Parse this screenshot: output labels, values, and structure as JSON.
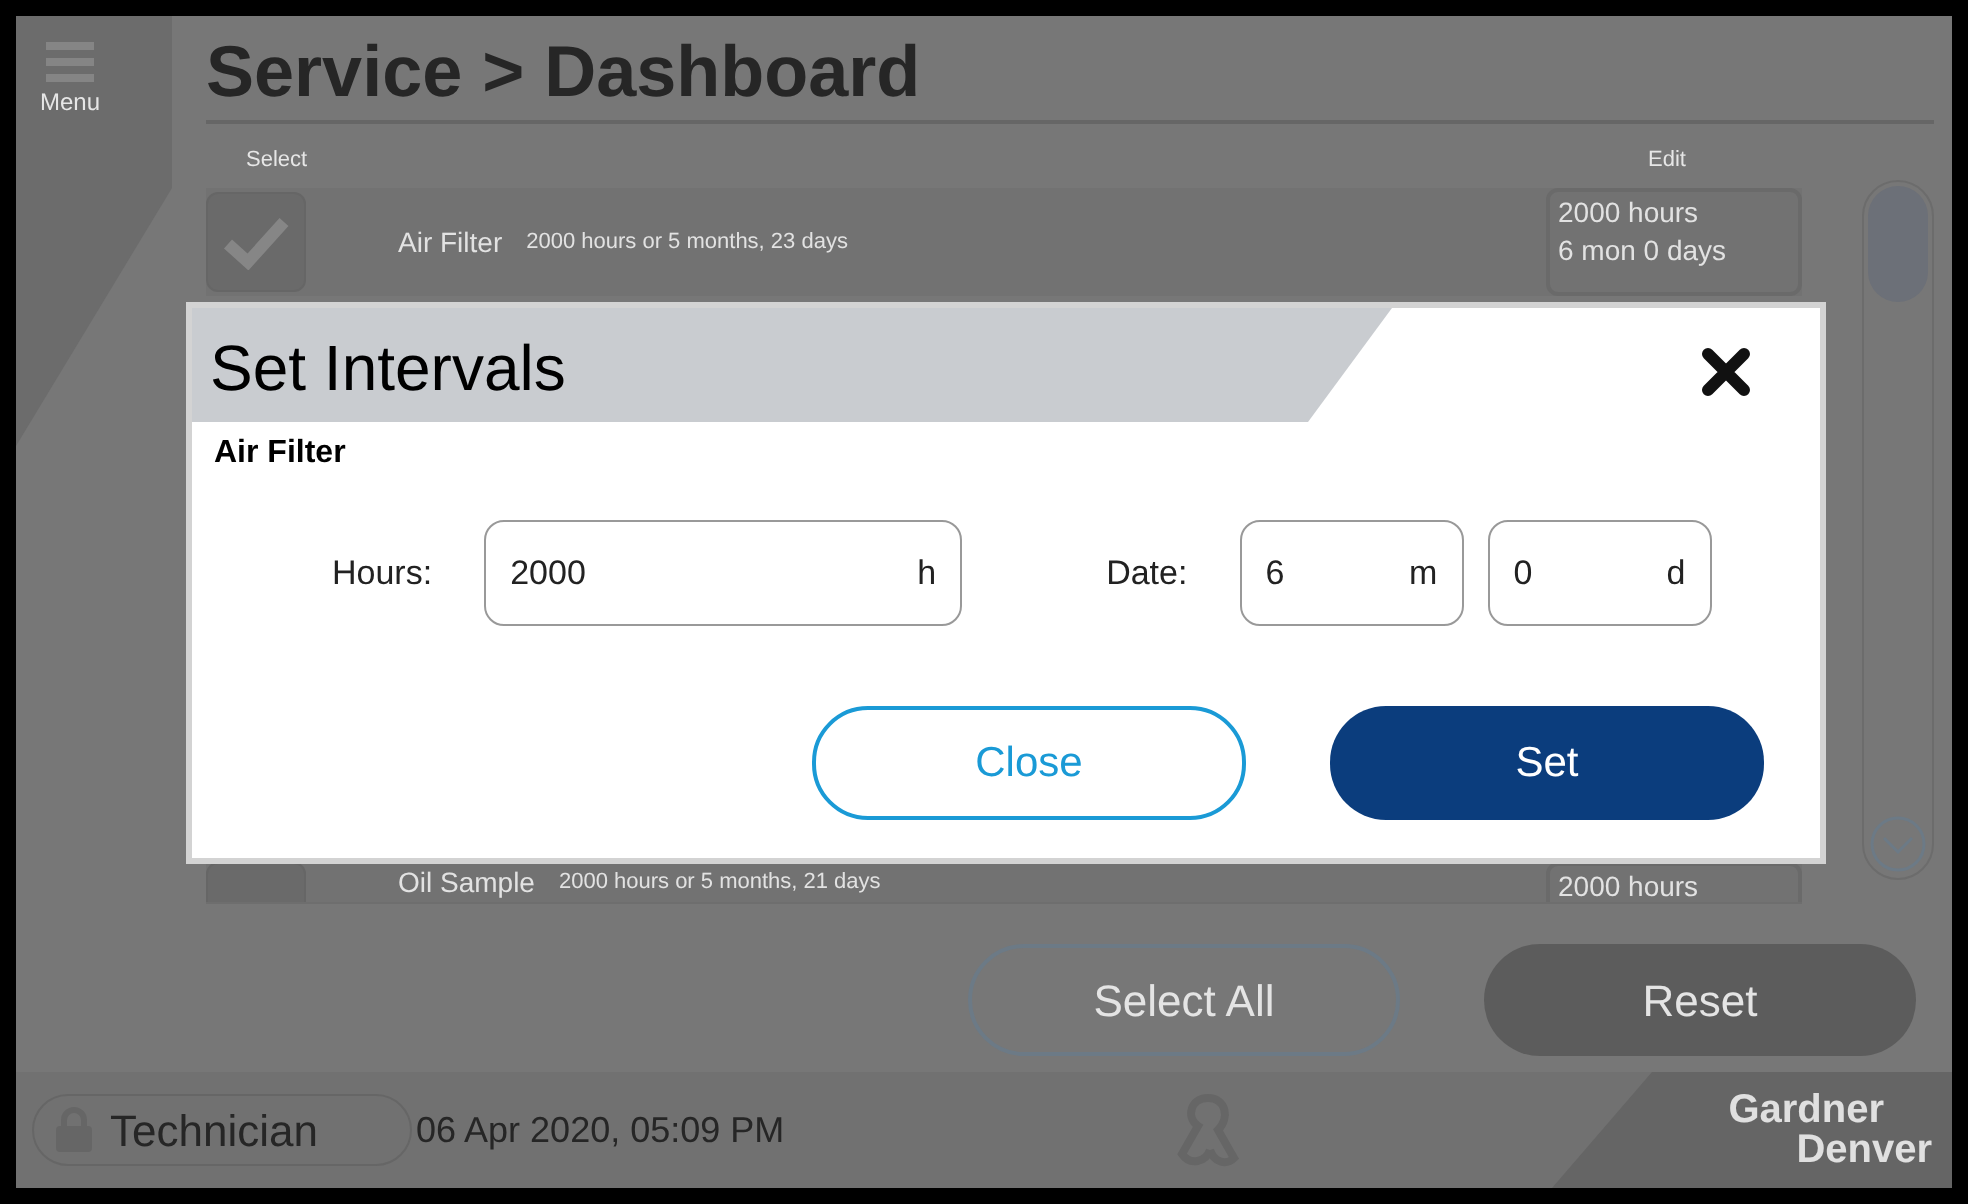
{
  "header": {
    "menu_label": "Menu",
    "title": "Service > Dashboard"
  },
  "list": {
    "select_heading": "Select",
    "edit_heading": "Edit",
    "items": [
      {
        "name": "Air Filter",
        "detail": "2000 hours or 5 months, 23 days",
        "checked": true,
        "edit_lines": [
          "2000 hours",
          "6 mon 0 days"
        ]
      },
      {
        "name": "Oil Sample",
        "detail": "2000 hours or 5 months, 21 days",
        "checked": false,
        "edit_lines": [
          "2000 hours"
        ]
      }
    ]
  },
  "actions": [
    {
      "label": "Select All",
      "kind": "outline"
    },
    {
      "label": "Reset",
      "kind": "filled"
    }
  ],
  "status_bar": {
    "user": "Technician",
    "datetime": "06 Apr 2020, 05:09 PM",
    "brand": [
      "Gardner",
      "Denver"
    ]
  },
  "dialog": {
    "title": "Set Intervals",
    "subtitle": "Air Filter",
    "fields": [
      {
        "label": "Hours:",
        "inputs": [
          {
            "value": "2000",
            "unit": "h"
          }
        ]
      },
      {
        "label": "Date:",
        "inputs": [
          {
            "value": "6",
            "unit": "m"
          },
          {
            "value": "0",
            "unit": "d"
          }
        ]
      }
    ],
    "buttons": [
      {
        "label": "Close",
        "kind": "outline"
      },
      {
        "label": "Set",
        "kind": "filled"
      }
    ]
  }
}
